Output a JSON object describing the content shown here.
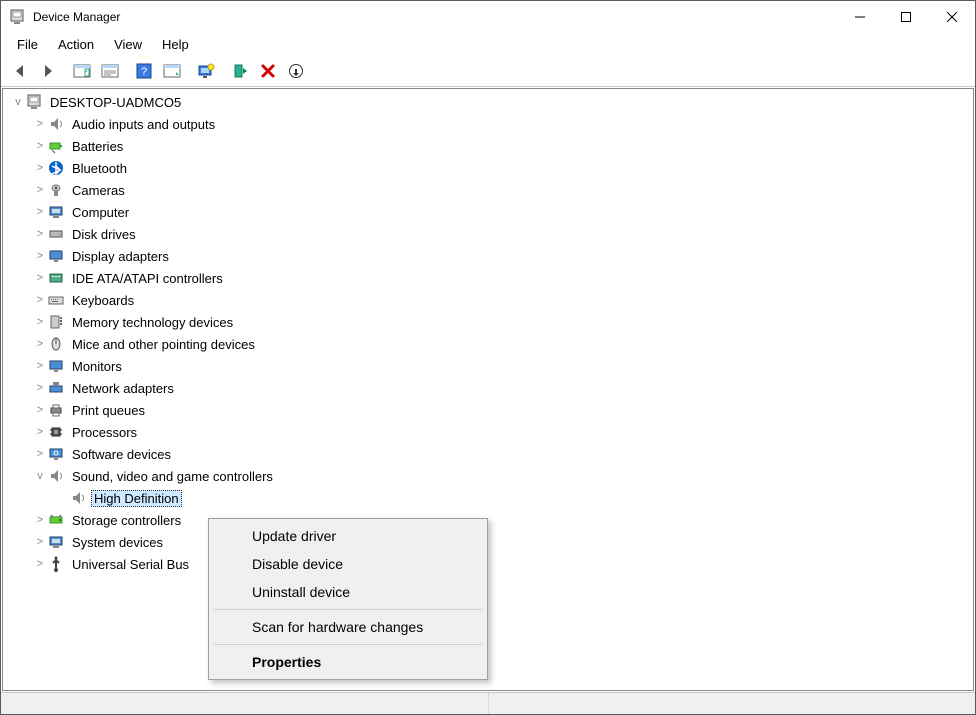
{
  "window": {
    "title": "Device Manager"
  },
  "menu": {
    "file": "File",
    "action": "Action",
    "view": "View",
    "help": "Help"
  },
  "toolbar_icons": [
    "back",
    "forward",
    "options-view",
    "show-hidden-devices",
    "help",
    "help-topics",
    "monitor-view",
    "add-legacy",
    "remove",
    "scan-hardware"
  ],
  "tree": {
    "root": "DESKTOP-UADMCO5",
    "root_expander": "v",
    "cat_expander": ">",
    "categories": [
      {
        "icon": "audio",
        "label": "Audio inputs and outputs",
        "expanded": false
      },
      {
        "icon": "battery",
        "label": "Batteries",
        "expanded": false
      },
      {
        "icon": "bluetooth",
        "label": "Bluetooth",
        "expanded": false
      },
      {
        "icon": "camera",
        "label": "Cameras",
        "expanded": false
      },
      {
        "icon": "computer",
        "label": "Computer",
        "expanded": false
      },
      {
        "icon": "disk",
        "label": "Disk drives",
        "expanded": false
      },
      {
        "icon": "display",
        "label": "Display adapters",
        "expanded": false
      },
      {
        "icon": "ide",
        "label": "IDE ATA/ATAPI controllers",
        "expanded": false
      },
      {
        "icon": "keyboard",
        "label": "Keyboards",
        "expanded": false
      },
      {
        "icon": "memory",
        "label": "Memory technology devices",
        "expanded": false
      },
      {
        "icon": "mouse",
        "label": "Mice and other pointing devices",
        "expanded": false
      },
      {
        "icon": "monitor",
        "label": "Monitors",
        "expanded": false
      },
      {
        "icon": "network",
        "label": "Network adapters",
        "expanded": false
      },
      {
        "icon": "printer",
        "label": "Print queues",
        "expanded": false
      },
      {
        "icon": "processor",
        "label": "Processors",
        "expanded": false
      },
      {
        "icon": "software",
        "label": "Software devices",
        "expanded": false
      },
      {
        "icon": "sound",
        "label": "Sound, video and game controllers",
        "expanded": true,
        "children": [
          {
            "icon": "speaker",
            "label": "High Definition",
            "selected": true
          }
        ]
      },
      {
        "icon": "storage",
        "label": "Storage controllers",
        "expanded": false
      },
      {
        "icon": "system",
        "label": "System devices",
        "expanded": false
      },
      {
        "icon": "usb",
        "label": "Universal Serial Bus",
        "expanded": false
      }
    ]
  },
  "context_menu": {
    "items": [
      {
        "label": "Update driver",
        "bold": false,
        "sep": false
      },
      {
        "label": "Disable device",
        "bold": false,
        "sep": false
      },
      {
        "label": "Uninstall device",
        "bold": false,
        "sep": false
      },
      {
        "sep": true
      },
      {
        "label": "Scan for hardware changes",
        "bold": false,
        "sep": false
      },
      {
        "sep": true
      },
      {
        "label": "Properties",
        "bold": true,
        "sep": false
      }
    ]
  }
}
